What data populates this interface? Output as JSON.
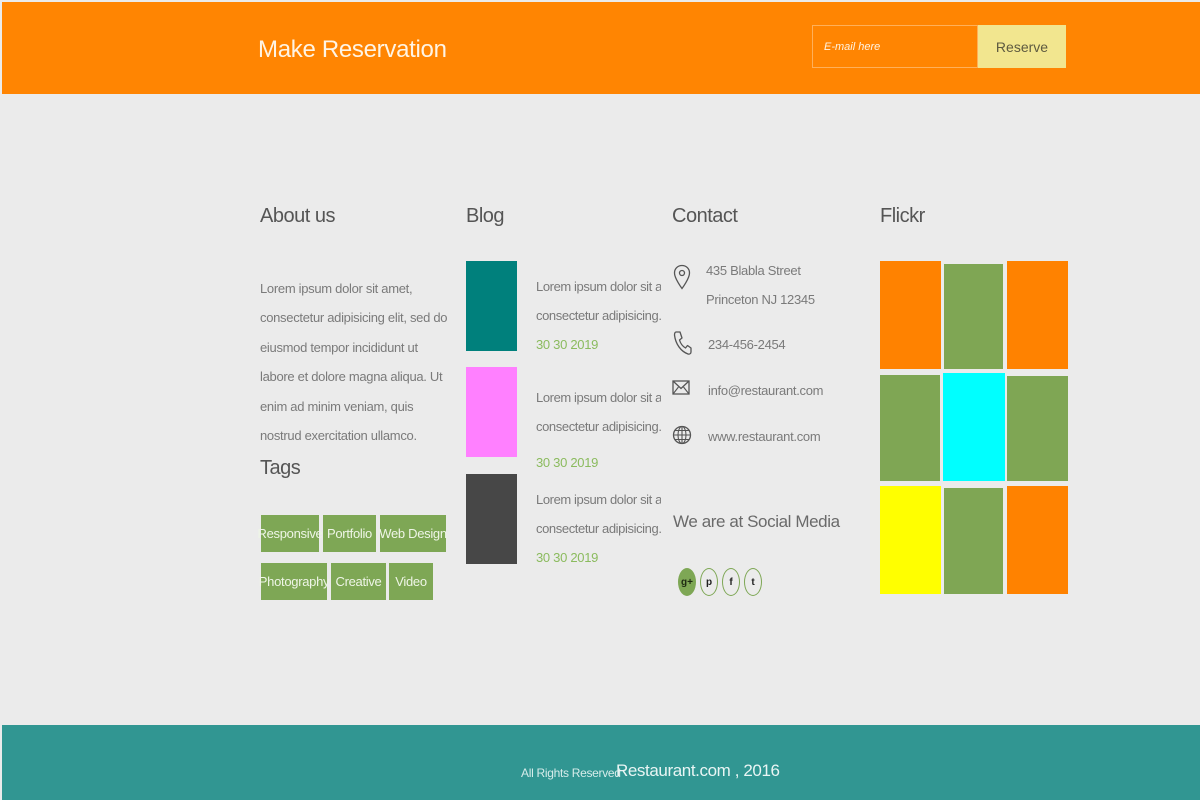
{
  "header": {
    "title": "Make Reservation",
    "email_placeholder": "E-mail here",
    "reserve_label": "Reserve",
    "bar_color": "#ff8502"
  },
  "about": {
    "heading": "About us",
    "text": "Lorem ipsum dolor sit amet, consectetur adipisicing elit, sed do eiusmod tempor incididunt ut labore et dolore magna aliqua. Ut enim ad minim veniam, quis nostrud exercitation ullamco."
  },
  "tags": {
    "heading": "Tags",
    "items": [
      "Responsive",
      "Portfolio",
      "Web Design",
      "Photography",
      "Creative",
      "Video"
    ],
    "color": "#7ea755"
  },
  "blog": {
    "heading": "Blog",
    "posts": [
      {
        "line1": "Lorem ipsum dolor sit ame",
        "line2": "consectetur adipisicing...",
        "date": "30 30 2019",
        "thumb_color": "#00807c"
      },
      {
        "line1": "Lorem ipsum dolor sit ame",
        "line2": "consectetur adipisicing...",
        "date": "30 30 2019",
        "thumb_color": "#ff80ff"
      },
      {
        "line1": "Lorem ipsum dolor sit ame",
        "line2": "consectetur adipisicing...",
        "date": "30 30 2019",
        "thumb_color": "#474747"
      }
    ]
  },
  "contact": {
    "heading": "Contact",
    "address_line1": "435 Blabla Street",
    "address_line2": "Princeton NJ 12345",
    "phone": "234-456-2454",
    "email": "info@restaurant.com",
    "website": "www.restaurant.com",
    "icons": [
      "location-pin-icon",
      "phone-icon",
      "envelope-icon",
      "globe-icon"
    ],
    "social_heading": "We are at Social Media",
    "social": [
      {
        "icon": "google-plus-icon",
        "glyph": "g+"
      },
      {
        "icon": "pinterest-icon",
        "glyph": "p"
      },
      {
        "icon": "facebook-icon",
        "glyph": "f"
      },
      {
        "icon": "twitter-icon",
        "glyph": "t"
      }
    ]
  },
  "flickr": {
    "heading": "Flickr",
    "tiles": [
      "#ff8200",
      "#7fa654",
      "#ff8200",
      "#7fa654",
      "#00ffff",
      "#7fa654",
      "#ffff00",
      "#7fa654",
      "#ff8200"
    ]
  },
  "footer": {
    "rights": "All Rights Reserved",
    "brand": "Restaurant.com , 2016",
    "bar_color": "#319692"
  }
}
